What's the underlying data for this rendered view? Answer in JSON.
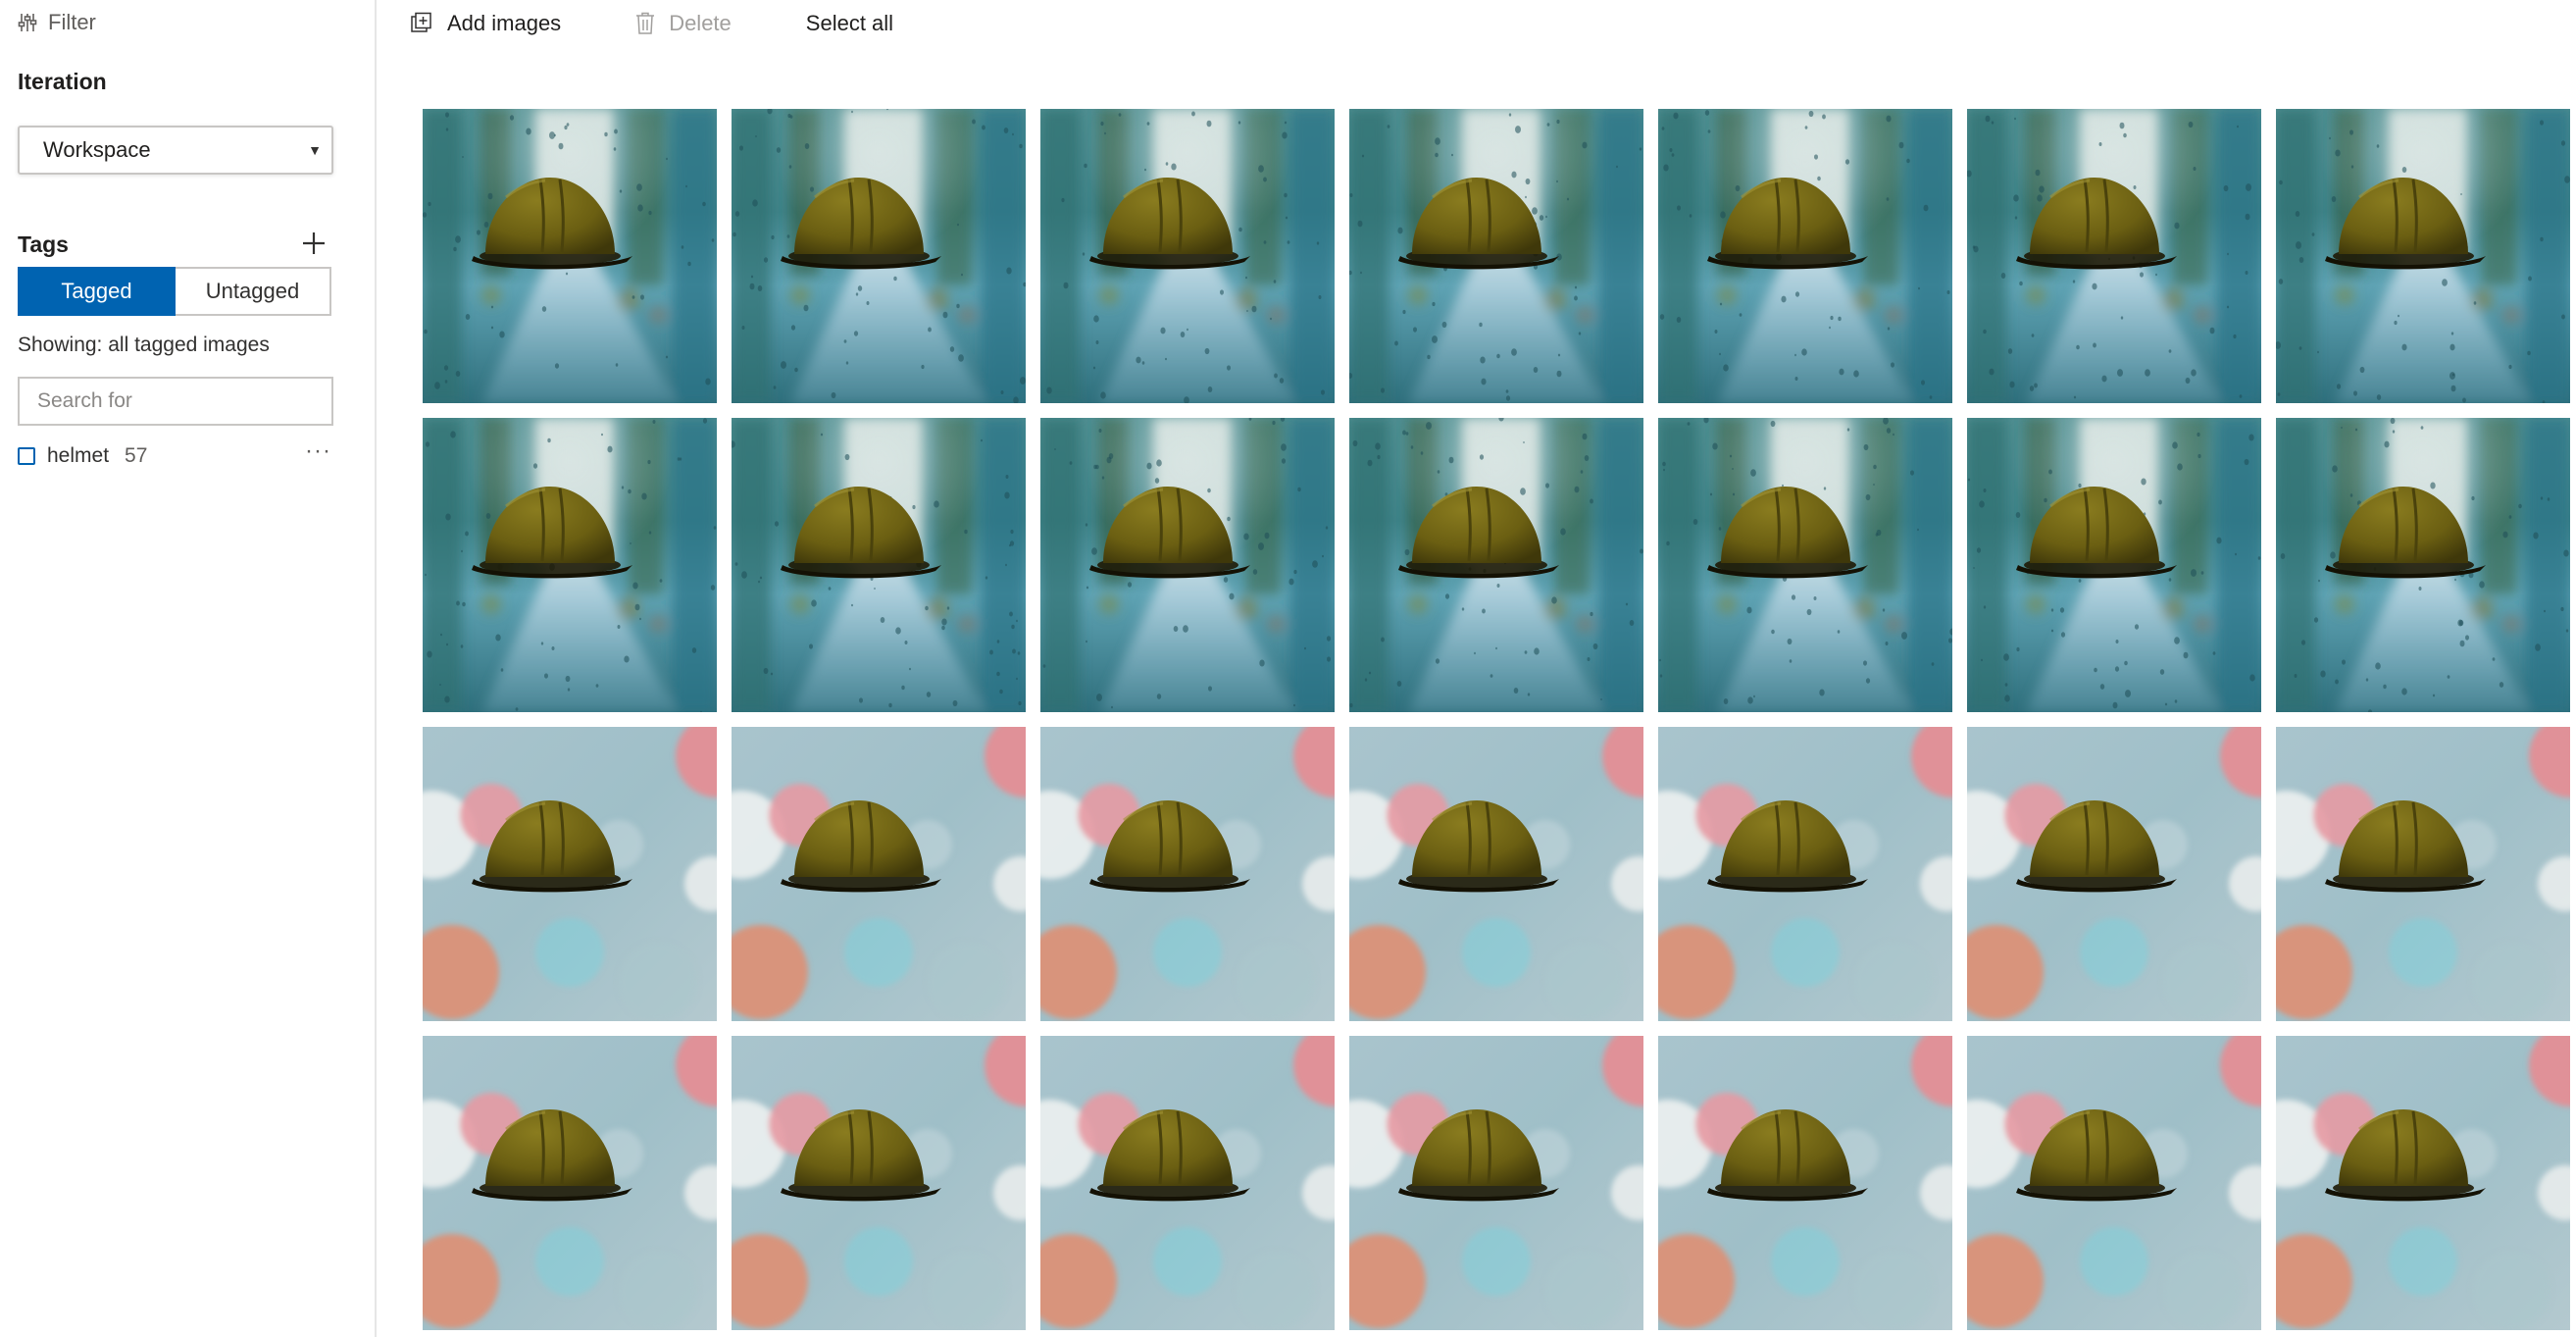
{
  "sidebar": {
    "filter_label": "Filter",
    "iteration_title": "Iteration",
    "iteration_value": "Workspace",
    "tags_title": "Tags",
    "toggle": {
      "tagged": "Tagged",
      "untagged": "Untagged"
    },
    "showing_text": "Showing: all tagged images",
    "search_placeholder": "Search for",
    "tags": [
      {
        "name": "helmet",
        "count": "57"
      }
    ]
  },
  "toolbar": {
    "add_label": "Add images",
    "delete_label": "Delete",
    "select_all_label": "Select all"
  },
  "colors": {
    "accent": "#0063b1",
    "helmet": "#6b5f12"
  },
  "grid": {
    "columns": 7,
    "rows": [
      {
        "background": "rainy-window"
      },
      {
        "background": "rainy-window"
      },
      {
        "background": "bokeh"
      },
      {
        "background": "bokeh"
      }
    ]
  }
}
